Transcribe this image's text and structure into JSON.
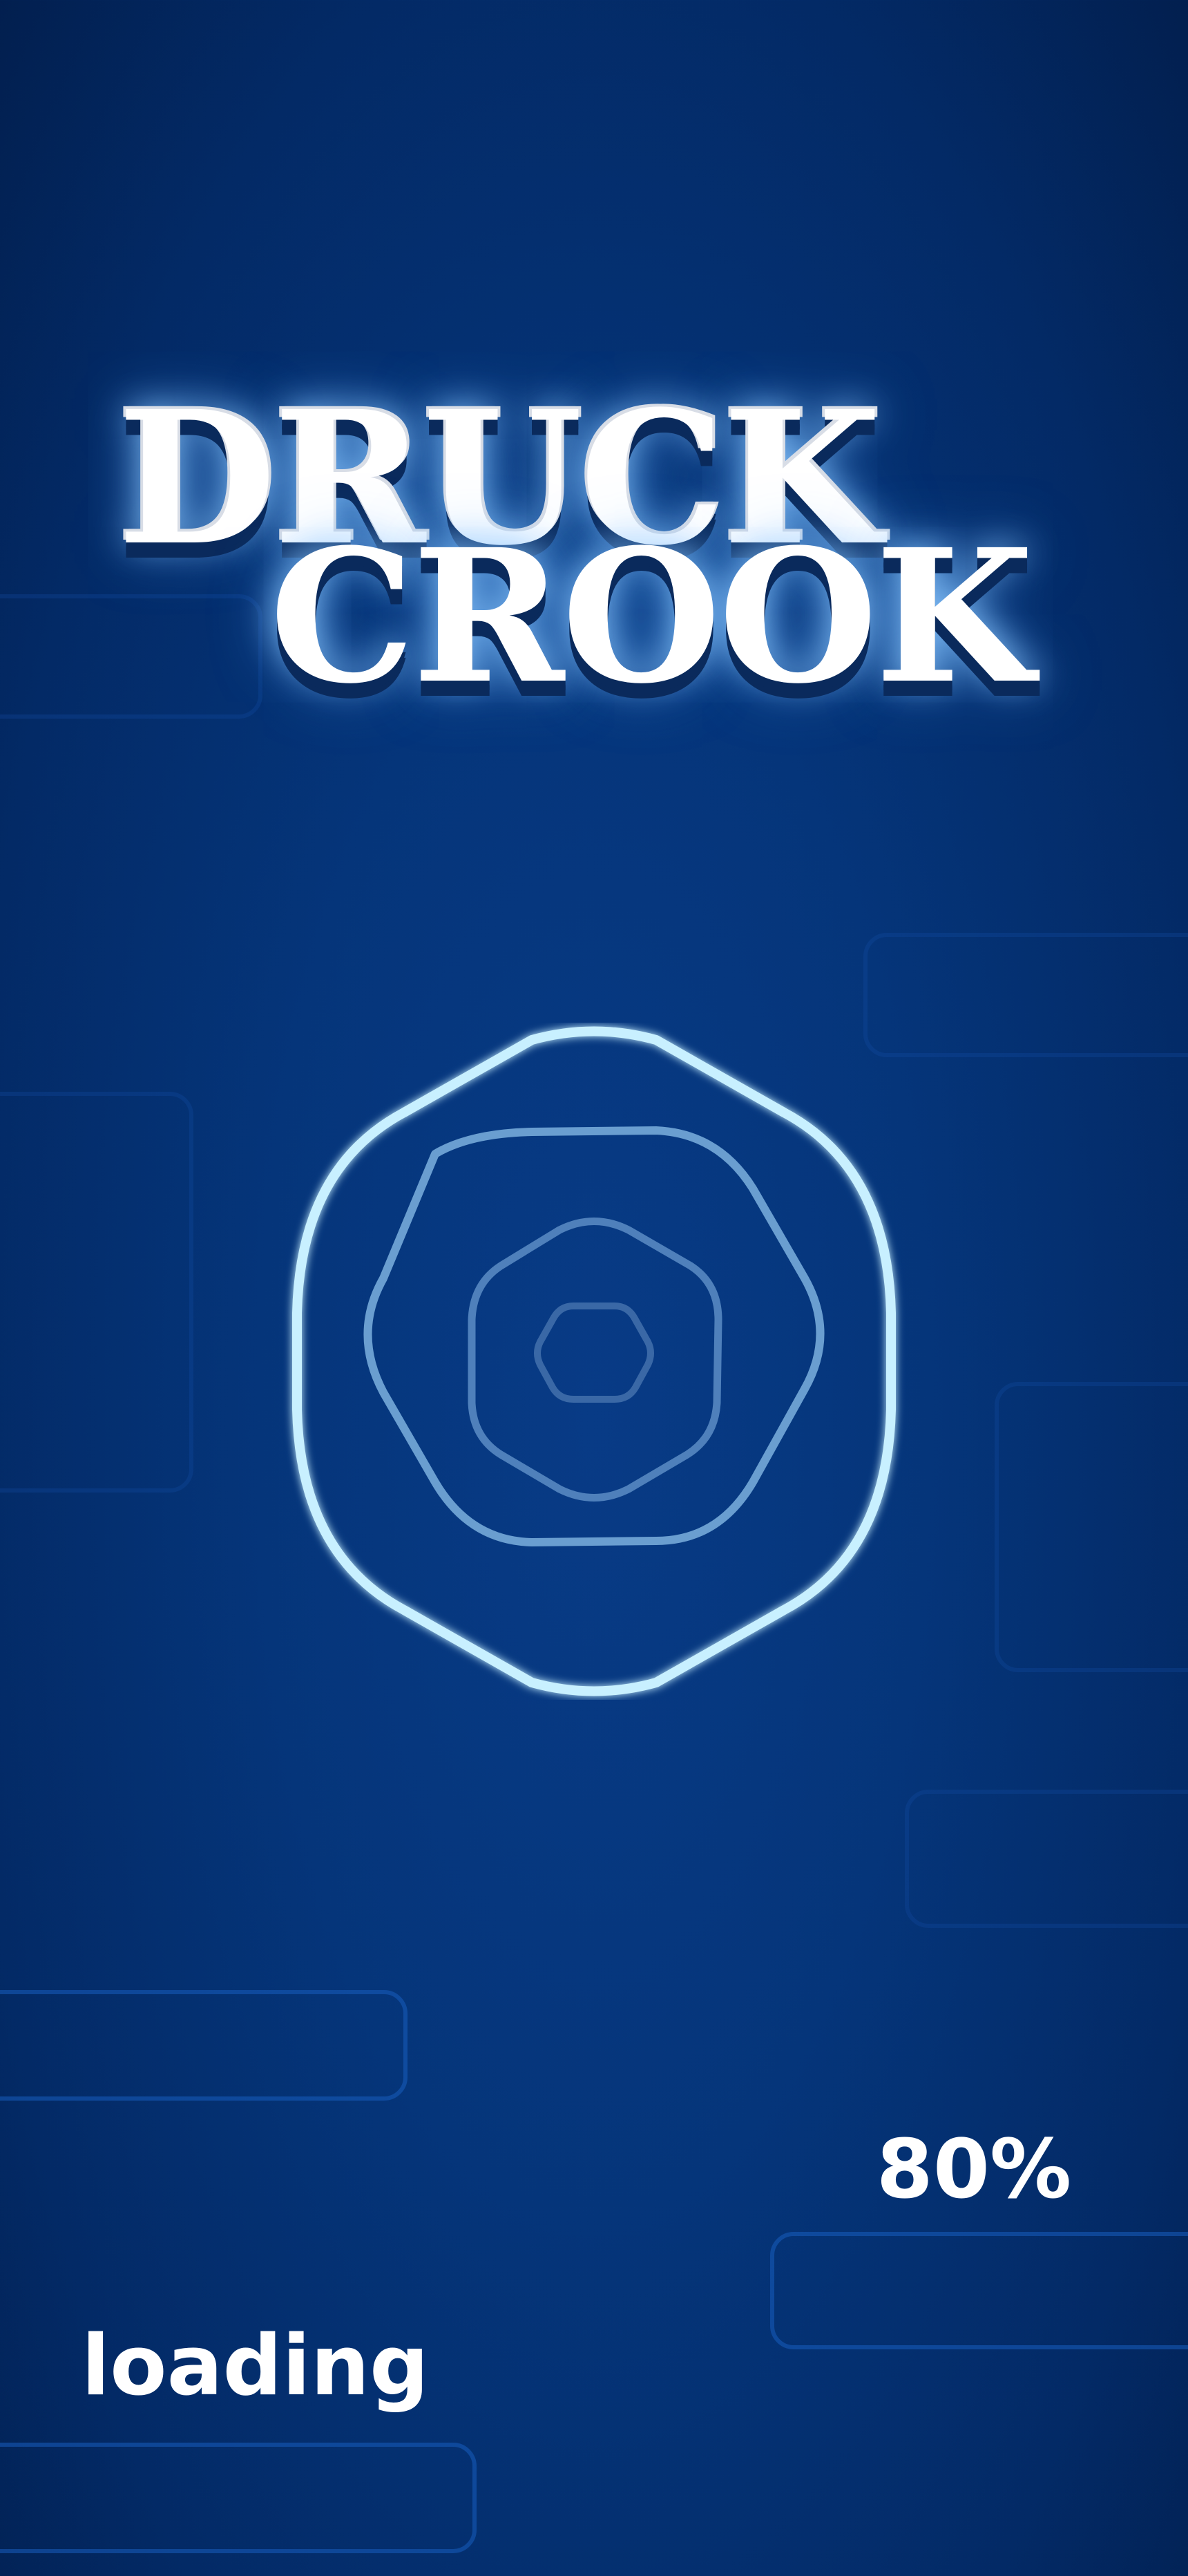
{
  "game": {
    "title_line1": "DRUCK",
    "title_line2": "CROOK"
  },
  "loader": {
    "percent_label": "80%",
    "progress_percent": 80,
    "status_label": "loading"
  },
  "colors": {
    "background": "#05357a",
    "outer_ring": "#c8f0ff",
    "inner_ring": "#6a9ed0",
    "text": "#ffffff",
    "tile_outline": "#185cbe"
  }
}
